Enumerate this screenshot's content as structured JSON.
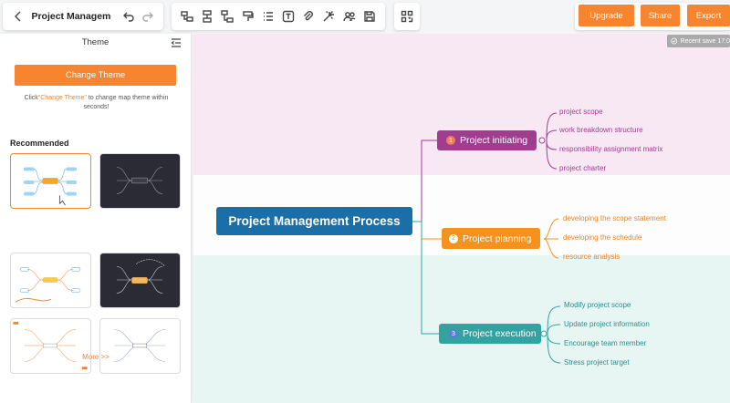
{
  "header": {
    "doc_title": "Project Management ...",
    "upgrade_label": "Upgrade",
    "share_label": "Share",
    "export_label": "Export",
    "save_status": "Recent save 17:0"
  },
  "toolbar": {
    "icons": [
      "topic-icon",
      "subtopic-icon",
      "floating-topic-icon",
      "format-painter-icon",
      "list-icon",
      "text-icon",
      "attachment-icon",
      "magic-icon",
      "collaborate-icon",
      "save-icon"
    ]
  },
  "panel": {
    "title": "Theme",
    "change_theme_label": "Change Theme",
    "hint_prefix": "Click",
    "hint_highlight": "\"Change Theme\"",
    "hint_suffix": " to change map theme within seconds!",
    "recommended_label": "Recommended",
    "more_label": "More >>"
  },
  "map": {
    "central": "Project Management Process",
    "branches": [
      {
        "num": "1",
        "label": "Project initiating",
        "color": "#a03d8f",
        "leaves": [
          "project scope",
          "work breakdown structure",
          "responsibility assignment matrix",
          "project charter"
        ]
      },
      {
        "num": "2",
        "label": "Project planning",
        "color": "#f5921e",
        "leaves": [
          "developing the scope statement",
          "developing the schedule",
          "resource analysis"
        ]
      },
      {
        "num": "3",
        "label": "Project execution",
        "color": "#32a3a0",
        "leaves": [
          "Modify project scope",
          "Update project information",
          "Encourage team member",
          "Stress project target"
        ]
      }
    ],
    "central_color": "#1b6fa8"
  }
}
